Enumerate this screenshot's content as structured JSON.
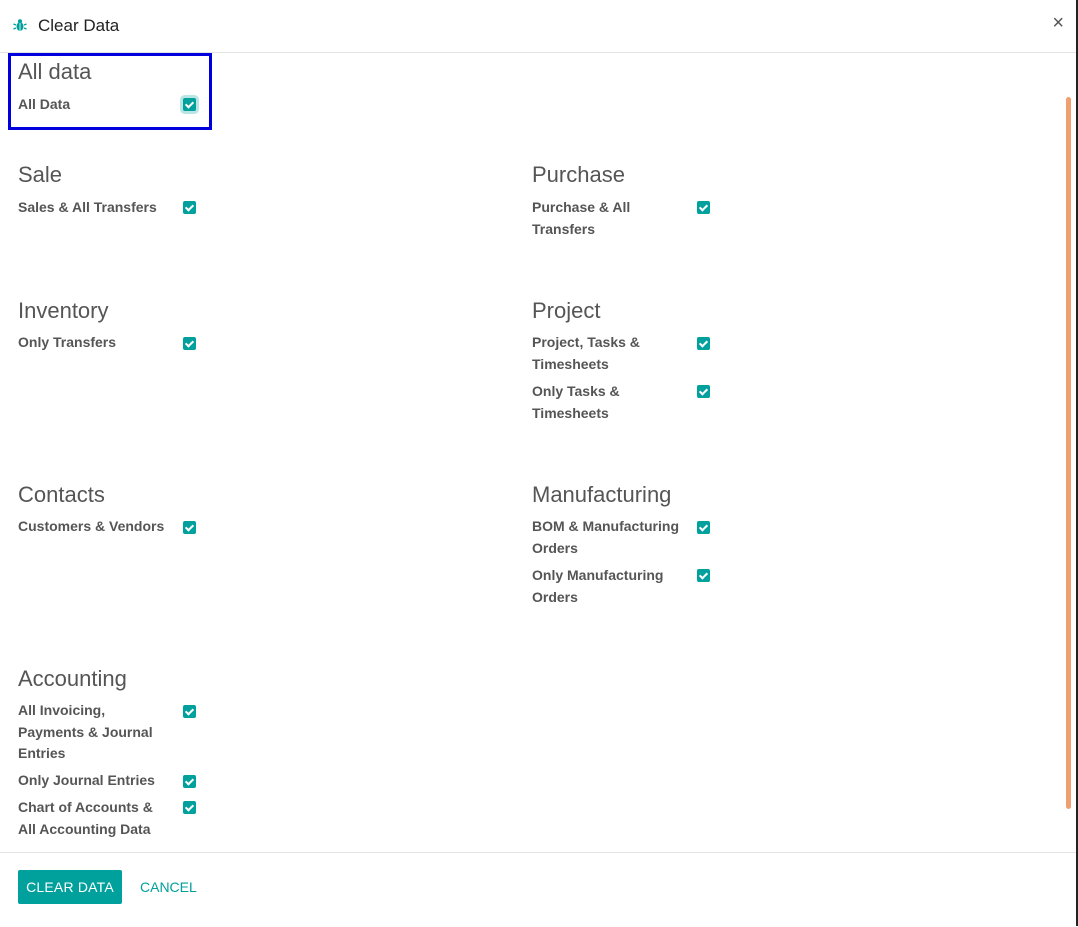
{
  "dialog": {
    "title": "Clear Data",
    "close_label": "×"
  },
  "sections": {
    "all_data": {
      "title": "All data",
      "options": [
        "All Data"
      ]
    },
    "sale": {
      "title": "Sale",
      "options": [
        "Sales & All Transfers"
      ]
    },
    "purchase": {
      "title": "Purchase",
      "options": [
        "Purchase & All Transfers"
      ]
    },
    "inventory": {
      "title": "Inventory",
      "options": [
        "Only Transfers"
      ]
    },
    "project": {
      "title": "Project",
      "options": [
        "Project, Tasks & Timesheets",
        "Only Tasks & Timesheets"
      ]
    },
    "contacts": {
      "title": "Contacts",
      "options": [
        "Customers & Vendors"
      ]
    },
    "manufacturing": {
      "title": "Manufacturing",
      "options": [
        "BOM & Manufacturing Orders",
        "Only Manufacturing Orders"
      ]
    },
    "accounting": {
      "title": "Accounting",
      "options": [
        "All Invoicing, Payments & Journal Entries",
        "Only Journal Entries",
        "Chart of Accounts & All Accounting Data"
      ]
    }
  },
  "footer": {
    "clear_label": "CLEAR DATA",
    "cancel_label": "CANCEL"
  },
  "colors": {
    "accent": "#00a09d",
    "highlight": "#0000dd",
    "scrollbar": "#f0a070"
  },
  "icons": {
    "header": "bug-icon",
    "close": "close-icon"
  }
}
